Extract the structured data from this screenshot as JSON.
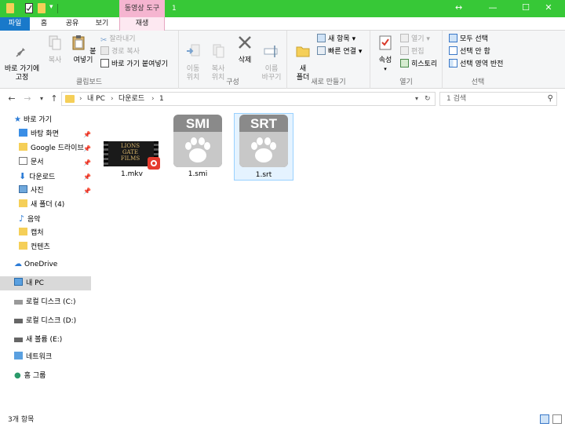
{
  "titlebar": {
    "context_tab": "동영상 도구",
    "window_title": "1",
    "colors": {
      "bar": "#37c837",
      "context_tab": "#f5b5d0"
    }
  },
  "tabs": {
    "file": "파일",
    "home": "홈",
    "share": "공유",
    "view": "보기",
    "play": "재생"
  },
  "ribbon": {
    "clipboard": {
      "label": "클립보드",
      "pin_quick": "바로 가기에\n고정",
      "copy": "복사",
      "paste": "붙여넣기",
      "cut": "잘라내기",
      "copy_path": "경로 복사",
      "paste_shortcut": "바로 가기 붙여넣기"
    },
    "organize": {
      "label": "구성",
      "move_to": "이동\n위치",
      "copy_to": "복사\n위치",
      "delete": "삭제",
      "rename": "이름\n바꾸기"
    },
    "new": {
      "label": "새로 만들기",
      "new_folder": "새\n폴더",
      "new_item": "새 항목",
      "easy_access": "빠른 연결"
    },
    "open": {
      "label": "열기",
      "properties": "속성",
      "open": "열기",
      "edit": "편집",
      "history": "히스토리"
    },
    "select": {
      "label": "선택",
      "select_all": "모두 선택",
      "select_none": "선택 안 함",
      "invert": "선택 영역 반전"
    }
  },
  "address": {
    "crumbs": [
      "내 PC",
      "다운로드",
      "1"
    ],
    "search_placeholder": "1 검색"
  },
  "nav": {
    "quick_access": "바로 가기",
    "items": [
      "바탕 화면",
      "Google 드라이브",
      "문서",
      "다운로드",
      "사진",
      "새 폴더 (4)",
      "음악",
      "캡처",
      "컨텐츠"
    ],
    "onedrive": "OneDrive",
    "this_pc": "내 PC",
    "drives": [
      "로컬 디스크 (C:)",
      "로컬 디스크 (D:)",
      "새 볼륨 (E:)"
    ],
    "network": "네트워크",
    "homegroup": "홈 그룹"
  },
  "files": [
    {
      "name": "1.mkv",
      "icon": "video-thumbnail-icon",
      "thumb_text": "LIONS\nGATE\nFILMS"
    },
    {
      "name": "1.smi",
      "icon": "smi-subtitle-icon",
      "badge": "SMI"
    },
    {
      "name": "1.srt",
      "icon": "srt-subtitle-icon",
      "badge": "SRT"
    }
  ],
  "status": {
    "count": "3개 항목"
  }
}
